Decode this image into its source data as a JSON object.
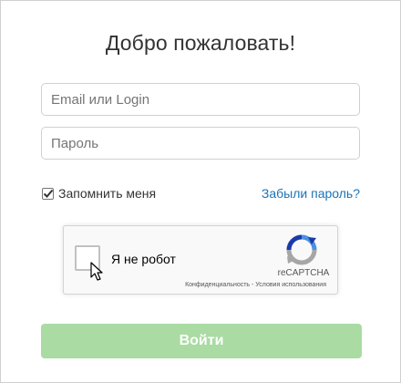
{
  "form": {
    "title": "Добро пожаловать!",
    "email_placeholder": "Email или Login",
    "password_placeholder": "Пароль",
    "remember_label": "Запомнить меня",
    "remember_checked": true,
    "forgot_label": "Забыли пароль?",
    "submit_label": "Войти"
  },
  "captcha": {
    "label": "Я не робот",
    "brand": "reCAPTCHA",
    "terms": "Конфиденциальность - Условия использования",
    "checked": false
  },
  "colors": {
    "link": "#1a73b8",
    "submit_bg": "#a9dba3",
    "recaptcha_blue": "#4a90e2",
    "recaptcha_dark": "#1c3aa9",
    "recaptcha_gray": "#a6a6a6"
  },
  "icons": {
    "remember_check": "checkmark-icon",
    "captcha_logo": "recaptcha-logo-icon",
    "pointer": "mouse-cursor-icon"
  }
}
